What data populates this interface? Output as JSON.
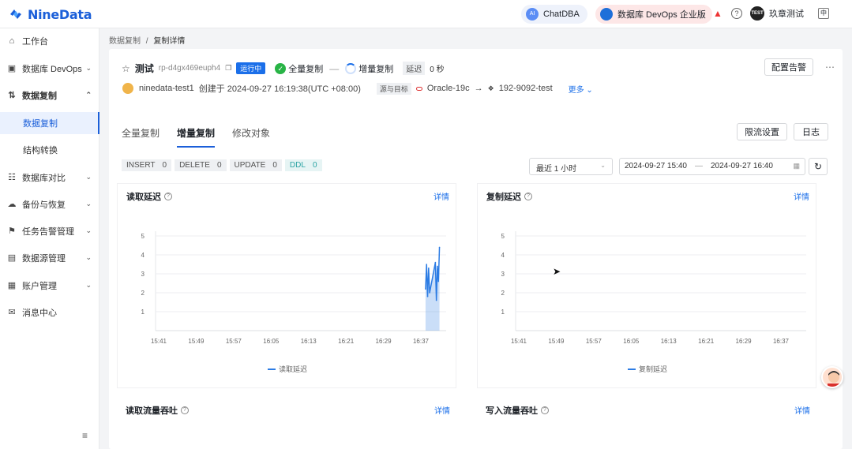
{
  "app": {
    "brand": "NineData"
  },
  "topbar": {
    "chatdba": "ChatDBA",
    "devops": "数据库 DevOps 企业版",
    "user_badge": "TEST",
    "user_name": "玖章测试",
    "lang_icon": "中"
  },
  "sidebar": {
    "items": [
      {
        "label": "工作台",
        "icon": "home-icon"
      },
      {
        "label": "数据库 DevOps",
        "icon": "monitor-icon"
      },
      {
        "label": "数据复制",
        "icon": "replicate-icon"
      },
      {
        "label": "数据复制",
        "icon": ""
      },
      {
        "label": "结构转换",
        "icon": ""
      },
      {
        "label": "数据库对比",
        "icon": "compare-icon"
      },
      {
        "label": "备份与恢复",
        "icon": "backup-icon"
      },
      {
        "label": "任务告警管理",
        "icon": "alarm-icon"
      },
      {
        "label": "数据源管理",
        "icon": "datasource-icon"
      },
      {
        "label": "账户管理",
        "icon": "account-icon"
      },
      {
        "label": "消息中心",
        "icon": "mail-icon"
      }
    ]
  },
  "breadcrumb": {
    "parent": "数据复制",
    "sep": "/",
    "current": "复制详情"
  },
  "task": {
    "name": "测试",
    "id": "rp-d4gx469euph4",
    "status": "运行中",
    "stage_full": "全量复制",
    "stage_incr": "增量复制",
    "lag_label": "延迟",
    "lag_value": "0 秒",
    "alarm_button": "配置告警",
    "creator": "ninedata-test1",
    "created_at": "创建于 2024-09-27 16:19:38(UTC +08:00)",
    "src_dst_label": "源与目标",
    "source": "Oracle-19c",
    "arrow": "→",
    "target": "192-9092-test",
    "more": "更多"
  },
  "tabs": [
    "全量复制",
    "增量复制",
    "修改对象"
  ],
  "actions": {
    "throttle": "限流设置",
    "log": "日志"
  },
  "counters": [
    {
      "label": "INSERT",
      "value": "0"
    },
    {
      "label": "DELETE",
      "value": "0"
    },
    {
      "label": "UPDATE",
      "value": "0"
    },
    {
      "label": "DDL",
      "value": "0"
    }
  ],
  "filter": {
    "range_select": "最近 1 小时",
    "start": "2024-09-27 15:40",
    "dash": "—",
    "end": "2024-09-27 16:40"
  },
  "panels": {
    "read_lag": {
      "title": "读取延迟",
      "detail": "详情",
      "legend": "读取延迟"
    },
    "repl_lag": {
      "title": "复制延迟",
      "detail": "详情",
      "legend": "复制延迟"
    },
    "read_tp": {
      "title": "读取流量吞吐",
      "detail": "详情"
    },
    "write_tp": {
      "title": "写入流量吞吐",
      "detail": "详情"
    }
  },
  "chart_data": [
    {
      "type": "area",
      "title": "读取延迟",
      "xlabel": "",
      "ylabel": "",
      "x_ticks": [
        "15:41",
        "15:49",
        "15:57",
        "16:05",
        "16:13",
        "16:21",
        "16:29",
        "16:37"
      ],
      "y_ticks": [
        1,
        2,
        3,
        4,
        5
      ],
      "ylim": [
        0,
        5
      ],
      "series": [
        {
          "name": "读取延迟",
          "color": "#2c7ce4",
          "x": [
            "16:38",
            "16:38",
            "16:38",
            "16:38",
            "16:38",
            "16:39",
            "16:39",
            "16:39",
            "16:39",
            "16:39"
          ],
          "values": [
            2.2,
            3.5,
            1.8,
            3.3,
            2.0,
            3.6,
            1.6,
            3.4,
            2.6,
            4.4
          ]
        }
      ],
      "grid": true
    },
    {
      "type": "line",
      "title": "复制延迟",
      "xlabel": "",
      "ylabel": "",
      "x_ticks": [
        "15:41",
        "15:49",
        "15:57",
        "16:05",
        "16:13",
        "16:21",
        "16:29",
        "16:37"
      ],
      "y_ticks": [
        1,
        2,
        3,
        4,
        5
      ],
      "ylim": [
        0,
        5
      ],
      "series": [
        {
          "name": "复制延迟",
          "color": "#2c7ce4",
          "x": [],
          "values": []
        }
      ],
      "grid": true
    }
  ]
}
